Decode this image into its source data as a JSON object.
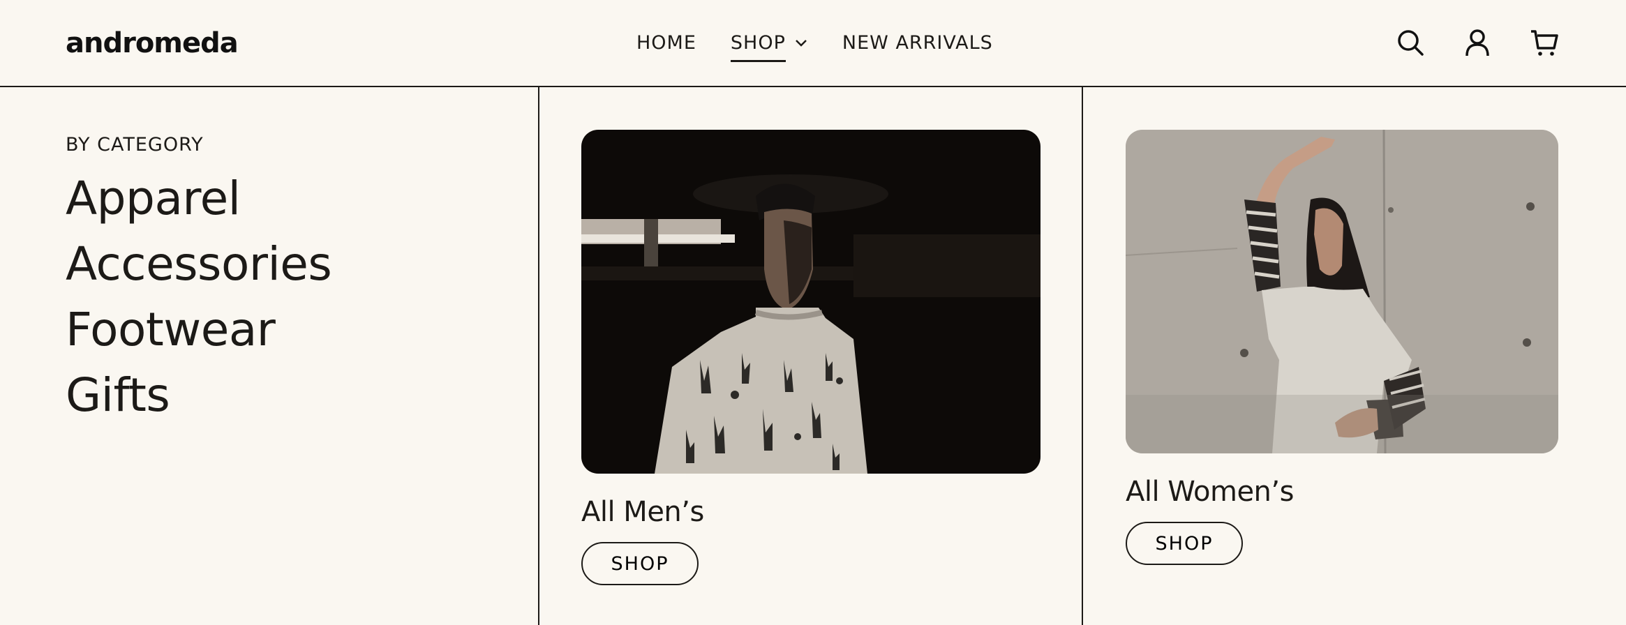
{
  "header": {
    "logo": "andromeda",
    "nav": [
      {
        "label": "HOME",
        "active": false
      },
      {
        "label": "SHOP",
        "active": true,
        "dropdown": true
      },
      {
        "label": "NEW ARRIVALS",
        "active": false
      }
    ],
    "icons": [
      "search-icon",
      "user-icon",
      "cart-icon"
    ]
  },
  "sidebar": {
    "heading": "BY CATEGORY",
    "categories": [
      "Apparel",
      "Accessories",
      "Footwear",
      "Gifts"
    ]
  },
  "cards": [
    {
      "title": "All Men’s",
      "button": "SHOP",
      "image": "man in cactus print sweatshirt and black cap in dark parking garage"
    },
    {
      "title": "All Women’s",
      "button": "SHOP",
      "image": "woman in oversized tee with striped sleeves posing against concrete wall"
    }
  ],
  "colors": {
    "background": "#faf7f1",
    "text": "#1c1a17"
  }
}
